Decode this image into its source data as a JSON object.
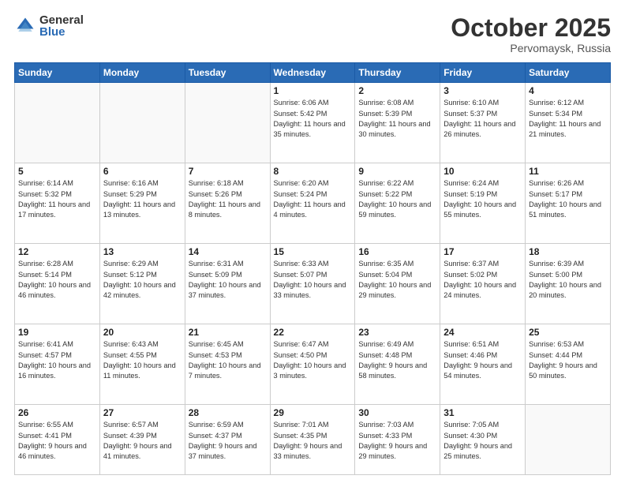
{
  "header": {
    "logo_general": "General",
    "logo_blue": "Blue",
    "month_title": "October 2025",
    "subtitle": "Pervomaysk, Russia"
  },
  "days_of_week": [
    "Sunday",
    "Monday",
    "Tuesday",
    "Wednesday",
    "Thursday",
    "Friday",
    "Saturday"
  ],
  "weeks": [
    [
      {
        "day": "",
        "info": ""
      },
      {
        "day": "",
        "info": ""
      },
      {
        "day": "",
        "info": ""
      },
      {
        "day": "1",
        "info": "Sunrise: 6:06 AM\nSunset: 5:42 PM\nDaylight: 11 hours\nand 35 minutes."
      },
      {
        "day": "2",
        "info": "Sunrise: 6:08 AM\nSunset: 5:39 PM\nDaylight: 11 hours\nand 30 minutes."
      },
      {
        "day": "3",
        "info": "Sunrise: 6:10 AM\nSunset: 5:37 PM\nDaylight: 11 hours\nand 26 minutes."
      },
      {
        "day": "4",
        "info": "Sunrise: 6:12 AM\nSunset: 5:34 PM\nDaylight: 11 hours\nand 21 minutes."
      }
    ],
    [
      {
        "day": "5",
        "info": "Sunrise: 6:14 AM\nSunset: 5:32 PM\nDaylight: 11 hours\nand 17 minutes."
      },
      {
        "day": "6",
        "info": "Sunrise: 6:16 AM\nSunset: 5:29 PM\nDaylight: 11 hours\nand 13 minutes."
      },
      {
        "day": "7",
        "info": "Sunrise: 6:18 AM\nSunset: 5:26 PM\nDaylight: 11 hours\nand 8 minutes."
      },
      {
        "day": "8",
        "info": "Sunrise: 6:20 AM\nSunset: 5:24 PM\nDaylight: 11 hours\nand 4 minutes."
      },
      {
        "day": "9",
        "info": "Sunrise: 6:22 AM\nSunset: 5:22 PM\nDaylight: 10 hours\nand 59 minutes."
      },
      {
        "day": "10",
        "info": "Sunrise: 6:24 AM\nSunset: 5:19 PM\nDaylight: 10 hours\nand 55 minutes."
      },
      {
        "day": "11",
        "info": "Sunrise: 6:26 AM\nSunset: 5:17 PM\nDaylight: 10 hours\nand 51 minutes."
      }
    ],
    [
      {
        "day": "12",
        "info": "Sunrise: 6:28 AM\nSunset: 5:14 PM\nDaylight: 10 hours\nand 46 minutes."
      },
      {
        "day": "13",
        "info": "Sunrise: 6:29 AM\nSunset: 5:12 PM\nDaylight: 10 hours\nand 42 minutes."
      },
      {
        "day": "14",
        "info": "Sunrise: 6:31 AM\nSunset: 5:09 PM\nDaylight: 10 hours\nand 37 minutes."
      },
      {
        "day": "15",
        "info": "Sunrise: 6:33 AM\nSunset: 5:07 PM\nDaylight: 10 hours\nand 33 minutes."
      },
      {
        "day": "16",
        "info": "Sunrise: 6:35 AM\nSunset: 5:04 PM\nDaylight: 10 hours\nand 29 minutes."
      },
      {
        "day": "17",
        "info": "Sunrise: 6:37 AM\nSunset: 5:02 PM\nDaylight: 10 hours\nand 24 minutes."
      },
      {
        "day": "18",
        "info": "Sunrise: 6:39 AM\nSunset: 5:00 PM\nDaylight: 10 hours\nand 20 minutes."
      }
    ],
    [
      {
        "day": "19",
        "info": "Sunrise: 6:41 AM\nSunset: 4:57 PM\nDaylight: 10 hours\nand 16 minutes."
      },
      {
        "day": "20",
        "info": "Sunrise: 6:43 AM\nSunset: 4:55 PM\nDaylight: 10 hours\nand 11 minutes."
      },
      {
        "day": "21",
        "info": "Sunrise: 6:45 AM\nSunset: 4:53 PM\nDaylight: 10 hours\nand 7 minutes."
      },
      {
        "day": "22",
        "info": "Sunrise: 6:47 AM\nSunset: 4:50 PM\nDaylight: 10 hours\nand 3 minutes."
      },
      {
        "day": "23",
        "info": "Sunrise: 6:49 AM\nSunset: 4:48 PM\nDaylight: 9 hours\nand 58 minutes."
      },
      {
        "day": "24",
        "info": "Sunrise: 6:51 AM\nSunset: 4:46 PM\nDaylight: 9 hours\nand 54 minutes."
      },
      {
        "day": "25",
        "info": "Sunrise: 6:53 AM\nSunset: 4:44 PM\nDaylight: 9 hours\nand 50 minutes."
      }
    ],
    [
      {
        "day": "26",
        "info": "Sunrise: 6:55 AM\nSunset: 4:41 PM\nDaylight: 9 hours\nand 46 minutes."
      },
      {
        "day": "27",
        "info": "Sunrise: 6:57 AM\nSunset: 4:39 PM\nDaylight: 9 hours\nand 41 minutes."
      },
      {
        "day": "28",
        "info": "Sunrise: 6:59 AM\nSunset: 4:37 PM\nDaylight: 9 hours\nand 37 minutes."
      },
      {
        "day": "29",
        "info": "Sunrise: 7:01 AM\nSunset: 4:35 PM\nDaylight: 9 hours\nand 33 minutes."
      },
      {
        "day": "30",
        "info": "Sunrise: 7:03 AM\nSunset: 4:33 PM\nDaylight: 9 hours\nand 29 minutes."
      },
      {
        "day": "31",
        "info": "Sunrise: 7:05 AM\nSunset: 4:30 PM\nDaylight: 9 hours\nand 25 minutes."
      },
      {
        "day": "",
        "info": ""
      }
    ]
  ]
}
